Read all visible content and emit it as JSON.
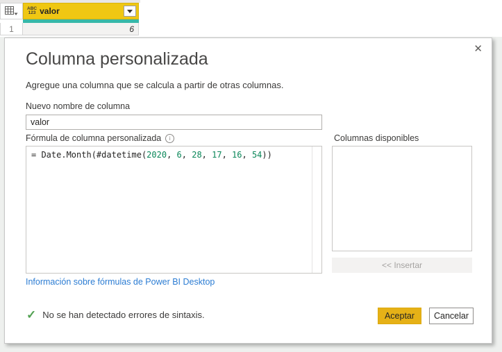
{
  "table": {
    "corner_icon": "table-grid-icon",
    "column": {
      "type_icon_lines": [
        "ABC",
        "123"
      ],
      "name": "valor",
      "filter_icon": "dropdown-caret"
    },
    "rows": [
      {
        "num": "1",
        "value": "6"
      }
    ]
  },
  "dialog": {
    "close_icon": "✕",
    "title": "Columna personalizada",
    "subtitle": "Agregue una columna que se calcula a partir de otras columnas.",
    "name_field": {
      "label": "Nuevo nombre de columna",
      "value": "valor"
    },
    "formula_field": {
      "label": "Fórmula de columna personalizada",
      "info_icon": "i",
      "tokens": [
        "= Date.Month(#datetime(",
        "2020",
        ", ",
        "6",
        ", ",
        "28",
        ", ",
        "17",
        ", ",
        "16",
        ", ",
        "54",
        "))"
      ]
    },
    "available_columns": {
      "label": "Columnas disponibles",
      "items": [],
      "insert_button": "<< Insertar"
    },
    "help_link": "Información sobre fórmulas de Power BI Desktop",
    "status": {
      "icon": "✓",
      "text": "No se han detectado errores de sintaxis."
    },
    "buttons": {
      "ok": "Aceptar",
      "cancel": "Cancelar"
    }
  },
  "colors": {
    "header_gold": "#efc713",
    "quality_bar_teal": "#37b8a8",
    "link_blue": "#2b7cd3",
    "success_green": "#52a152",
    "formula_number_green": "#098658",
    "ok_button_gold": "#e6b117",
    "dialog_bg": "#ffffff",
    "page_bg": "#eef0ee"
  }
}
